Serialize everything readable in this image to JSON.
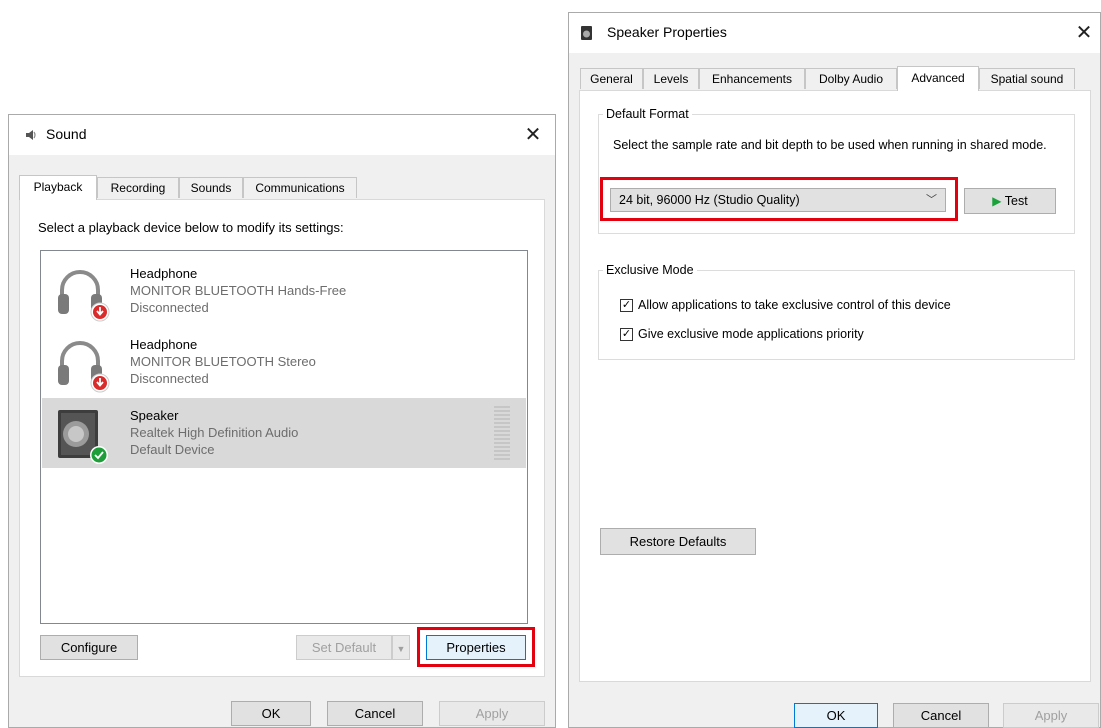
{
  "sound_dialog": {
    "title": "Sound",
    "tabs": [
      "Playback",
      "Recording",
      "Sounds",
      "Communications"
    ],
    "instruction": "Select a playback device below to modify its settings:",
    "devices": [
      {
        "name": "Headphone",
        "description": "MONITOR BLUETOOTH Hands-Free",
        "status": "Disconnected",
        "icon": "headphone-icon",
        "badge": "disconnected-arrow"
      },
      {
        "name": "Headphone",
        "description": "MONITOR BLUETOOTH Stereo",
        "status": "Disconnected",
        "icon": "headphone-icon",
        "badge": "disconnected-arrow"
      },
      {
        "name": "Speaker",
        "description": "Realtek High Definition Audio",
        "status": "Default Device",
        "icon": "speaker-icon",
        "badge": "default-check"
      }
    ],
    "buttons": {
      "configure": "Configure",
      "set_default": "Set Default",
      "properties": "Properties",
      "ok": "OK",
      "cancel": "Cancel",
      "apply": "Apply"
    }
  },
  "speaker_properties": {
    "title": "Speaker Properties",
    "tabs": [
      "General",
      "Levels",
      "Enhancements",
      "Dolby Audio",
      "Advanced",
      "Spatial sound"
    ],
    "active_tab": "Advanced",
    "default_format": {
      "group_title": "Default Format",
      "description": "Select the sample rate and bit depth to be used when running in shared mode.",
      "selected_format": "24 bit, 96000 Hz (Studio Quality)",
      "test_label": "Test"
    },
    "exclusive_mode": {
      "group_title": "Exclusive Mode",
      "allow_exclusive_label": "Allow applications to take exclusive control of this device",
      "allow_exclusive_checked": true,
      "priority_label": "Give exclusive mode applications priority",
      "priority_checked": true
    },
    "buttons": {
      "restore_defaults": "Restore Defaults",
      "ok": "OK",
      "cancel": "Cancel",
      "apply": "Apply"
    }
  },
  "colors": {
    "highlight_red": "#e3000f",
    "disconnected_badge": "#d92b2b",
    "default_badge": "#1f9d3a",
    "test_play": "#1aa33b"
  }
}
